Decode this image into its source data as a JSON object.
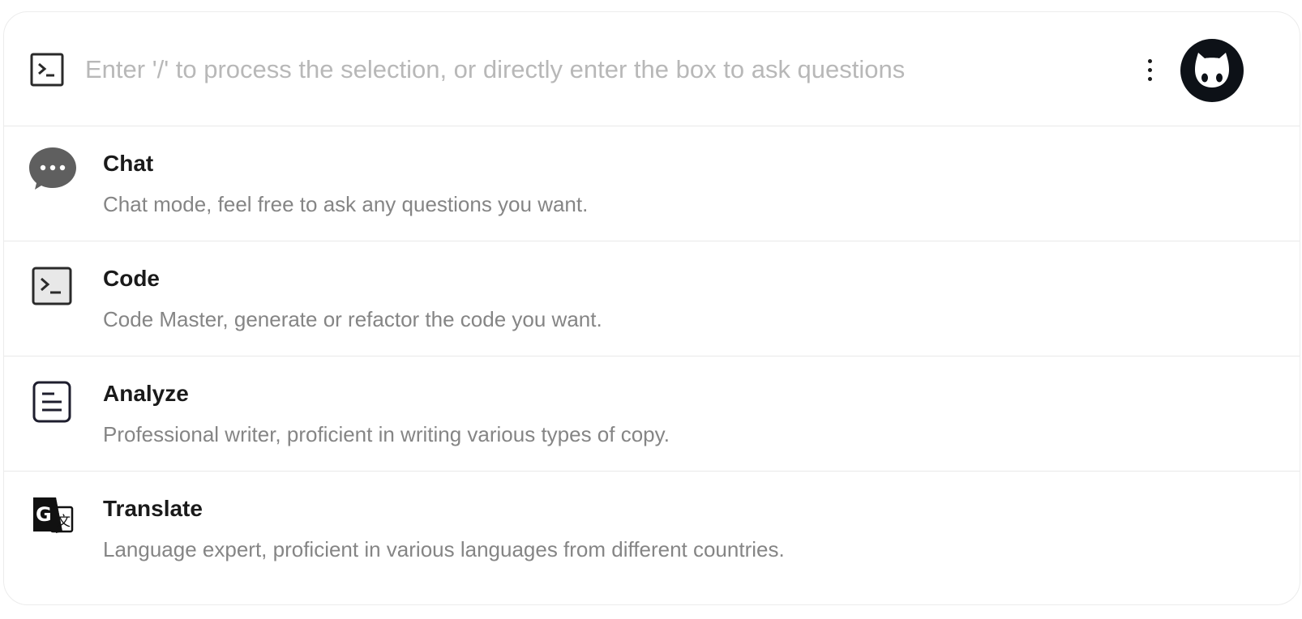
{
  "search": {
    "placeholder": "Enter '/' to process the selection, or directly enter the box to ask questions",
    "value": "",
    "icon": "terminal-icon"
  },
  "header": {
    "more_icon": "more-vertical-icon",
    "avatar_icon": "ghost-avatar-icon"
  },
  "modes": [
    {
      "title": "Chat",
      "description": "Chat mode, feel free to ask any questions you want.",
      "icon": "chat-bubble-icon"
    },
    {
      "title": "Code",
      "description": "Code Master, generate or refactor the code you want.",
      "icon": "terminal-icon"
    },
    {
      "title": "Analyze",
      "description": "Professional writer, proficient in writing various types of copy.",
      "icon": "document-icon"
    },
    {
      "title": "Translate",
      "description": "Language expert, proficient in various languages from different countries.",
      "icon": "translate-icon"
    }
  ],
  "colors": {
    "title": "#1a1a1a",
    "description": "#858585",
    "placeholder": "#b8b8b8",
    "divider": "#e9e9e9",
    "chat_icon": "#5f5f5f"
  }
}
